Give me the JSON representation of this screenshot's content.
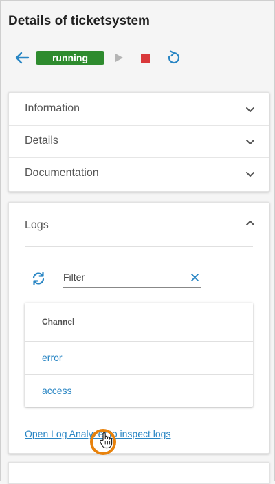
{
  "page": {
    "title": "Details of ticketsystem"
  },
  "toolbar": {
    "back_icon": "arrow-left-icon",
    "status": "running",
    "status_color": "#2e8b2e",
    "play_icon": "play-icon",
    "stop_icon": "stop-icon",
    "restart_icon": "restart-icon"
  },
  "sections": [
    {
      "label": "Information",
      "expanded": false
    },
    {
      "label": "Details",
      "expanded": false
    },
    {
      "label": "Documentation",
      "expanded": false
    }
  ],
  "logs": {
    "label": "Logs",
    "expanded": true,
    "filter": {
      "placeholder": "Filter",
      "value": ""
    },
    "table": {
      "header": "Channel",
      "rows": [
        "error",
        "access"
      ]
    },
    "link": "Open Log Analyzer to inspect logs"
  },
  "colors": {
    "accent": "#2a86c4",
    "stop": "#d9383a",
    "cursor_ring": "#e8820c"
  }
}
